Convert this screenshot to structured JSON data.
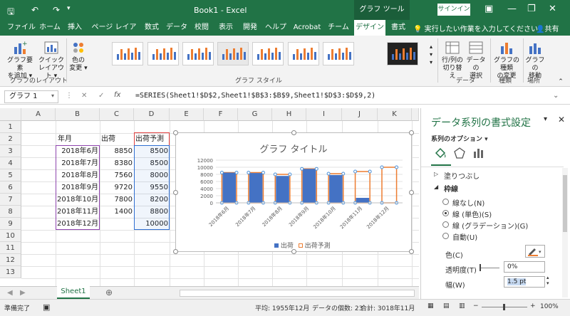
{
  "titlebar": {
    "title": "Book1 - Excel",
    "context_tab": "グラフ ツール",
    "signin": "サインイン",
    "min": "—",
    "restore": "❐",
    "close": "✕",
    "ribbon_display": "▣"
  },
  "tabs": [
    {
      "label": "ファイル"
    },
    {
      "label": "ホーム"
    },
    {
      "label": "挿入"
    },
    {
      "label": "ページ レイアウト"
    },
    {
      "label": "数式"
    },
    {
      "label": "データ"
    },
    {
      "label": "校閲"
    },
    {
      "label": "表示"
    },
    {
      "label": "開発"
    },
    {
      "label": "ヘルプ"
    },
    {
      "label": "Acrobat"
    },
    {
      "label": "チーム"
    },
    {
      "label": "デザイン"
    },
    {
      "label": "書式"
    }
  ],
  "tell_me": "実行したい作業を入力してください",
  "share": "共有",
  "ribbon": {
    "add_element": "グラフ要素\nを追加 ▾",
    "quick_layout": "クイック\nレイアウト ▾",
    "change_colors": "色の\n変更 ▾",
    "group_layout": "グラフのレイアウト",
    "group_styles": "グラフ スタイル",
    "switch_row_col": "行/列の\n切り替え",
    "select_data": "データの\n選択",
    "group_data": "データ",
    "change_type": "グラフの種類\nの変更",
    "group_type": "種類",
    "move_chart": "グラフの\n移動",
    "group_location": "場所"
  },
  "formula_bar": {
    "name_box": "グラフ 1",
    "cancel": "✕",
    "enter": "✓",
    "fx": "fx",
    "formula": "=SERIES(Sheet1!$D$2,Sheet1!$B$3:$B$9,Sheet1!$D$3:$D$9,2)"
  },
  "grid": {
    "columns": [
      "A",
      "B",
      "C",
      "D",
      "E",
      "F",
      "G",
      "H",
      "I",
      "J",
      "K"
    ],
    "rows": [
      "1",
      "2",
      "3",
      "4",
      "5",
      "6",
      "7",
      "8",
      "9",
      "10",
      "11",
      "12",
      "13"
    ],
    "headers": {
      "b2": "年月",
      "c2": "出荷",
      "d2": "出荷予測"
    },
    "data": [
      {
        "b": "2018年6月",
        "c": "8850",
        "d": "8500"
      },
      {
        "b": "2018年7月",
        "c": "8380",
        "d": "8500"
      },
      {
        "b": "2018年8月",
        "c": "7560",
        "d": "8000"
      },
      {
        "b": "2018年9月",
        "c": "9720",
        "d": "9550"
      },
      {
        "b": "2018年10月",
        "c": "7800",
        "d": "8200"
      },
      {
        "b": "2018年11月",
        "c": "1400",
        "d": "8800"
      },
      {
        "b": "2018年12月",
        "c": "",
        "d": "10000"
      }
    ]
  },
  "chart_data": {
    "type": "bar",
    "title": "グラフ タイトル",
    "categories": [
      "2018年6月",
      "2018年7月",
      "2018年8月",
      "2018年9月",
      "2018年10月",
      "2018年11月",
      "2018年12月"
    ],
    "series": [
      {
        "name": "出荷",
        "values": [
          8850,
          8380,
          7560,
          9720,
          7800,
          1400,
          null
        ],
        "color": "#4472c4"
      },
      {
        "name": "出荷予測",
        "values": [
          8500,
          8500,
          8000,
          9550,
          8200,
          8800,
          10000
        ],
        "color": "#ed7d31"
      }
    ],
    "yticks": [
      "12000",
      "10000",
      "8000",
      "6000",
      "4000",
      "2000",
      "0"
    ],
    "ylim": [
      0,
      12000
    ],
    "legend": "bottom"
  },
  "sheet_tabs": {
    "active": "Sheet1",
    "add": "⊕"
  },
  "status": {
    "ready": "準備完了",
    "average": "平均: 1955年12月",
    "count": "データの個数: 23",
    "sum": "合計: 3018年11月",
    "zoom": "100%"
  },
  "pane": {
    "title": "データ系列の書式設定",
    "options": "系列のオプション ▾",
    "fill": "塗りつぶし",
    "line": "枠線",
    "no_line": "線なし(N)",
    "solid_line": "線 (単色)(S)",
    "gradient_line": "線 (グラデーション)(G)",
    "auto": "自動(U)",
    "color": "色(C)",
    "transparency": "透明度(T)",
    "transparency_value": "0%",
    "width": "幅(W)",
    "width_value": "1.5 pt"
  },
  "colors": {
    "excel_green": "#217346",
    "blue": "#4472c4",
    "orange": "#ed7d31"
  }
}
